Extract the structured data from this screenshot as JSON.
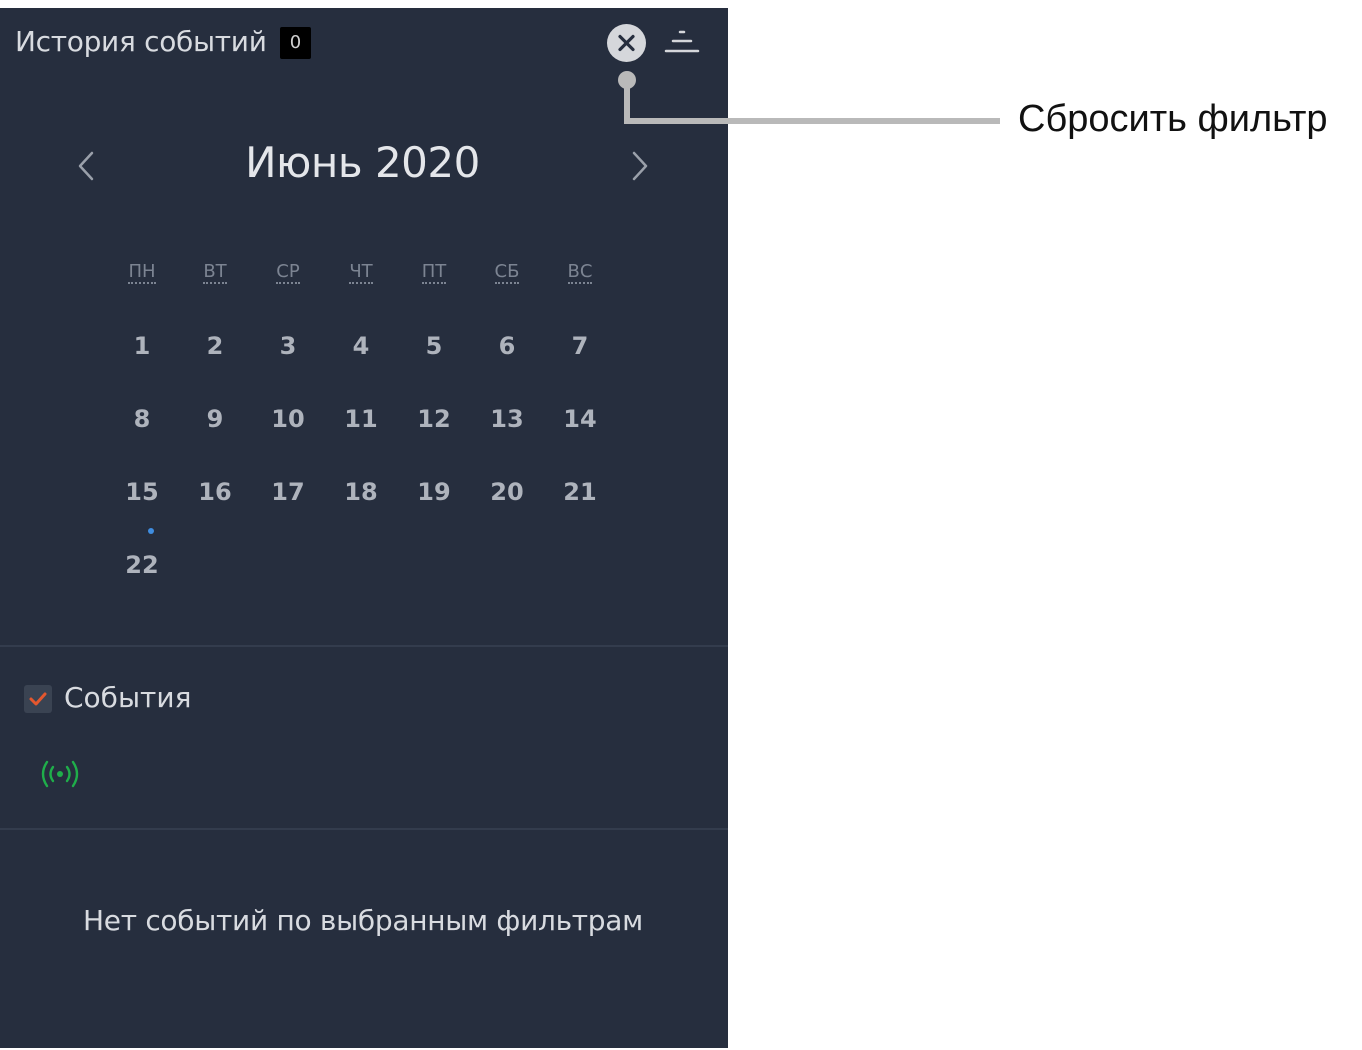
{
  "header": {
    "title": "История событий",
    "count": "0"
  },
  "calendar": {
    "month_title": "Июнь 2020",
    "weekdays": [
      "ПН",
      "ВТ",
      "СР",
      "ЧТ",
      "ПТ",
      "СБ",
      "ВС"
    ],
    "days": [
      "1",
      "2",
      "3",
      "4",
      "5",
      "6",
      "7",
      "8",
      "9",
      "10",
      "11",
      "12",
      "13",
      "14",
      "15",
      "16",
      "17",
      "18",
      "19",
      "20",
      "21",
      "22"
    ],
    "marked_day": "22"
  },
  "filters": {
    "events_label": "События",
    "events_checked": true
  },
  "empty_message": "Нет событий по выбранным фильтрам",
  "annotation": {
    "label": "Сбросить фильтр"
  },
  "colors": {
    "panel_bg": "#262e3e",
    "checkbox_check": "#e4572e",
    "signal_icon": "#1fae4a",
    "event_dot": "#3f8de0",
    "callout_line": "#b9b9b9"
  }
}
